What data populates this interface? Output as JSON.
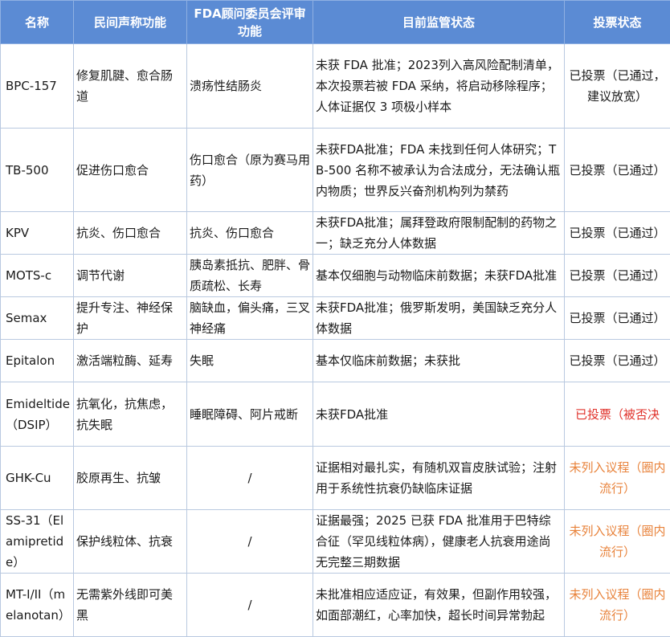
{
  "table": {
    "headers": [
      "名称",
      "民间声称功能",
      "FDA顾问委员会评审功能",
      "目前监管状态",
      "投票状态"
    ],
    "rows": [
      {
        "name": "BPC-157",
        "claimed": "修复肌腱、愈合肠道",
        "fda_function": "溃疡性结肠炎",
        "regulatory": "未获 FDA 批准；2023列入高风险配制清单，本次投票若被 FDA 采纳，将启动移除程序；人体证据仅 3 项极小样本",
        "vote": "已投票（已通过， 建议放宽）",
        "vote_type": "passed"
      },
      {
        "name": "TB-500",
        "claimed": "促进伤口愈合",
        "fda_function": "伤口愈合（原为赛马用药）",
        "regulatory": "未获FDA批准；FDA 未找到任何人体研究；TB-500 名称不被承认为合法成分，无法确认瓶内物质；世界反兴奋剂机构列为禁药",
        "vote": "已投票（已通过）",
        "vote_type": "passed"
      },
      {
        "name": "KPV",
        "claimed": "抗炎、伤口愈合",
        "fda_function": "抗炎、伤口愈合",
        "regulatory": "未获FDA批准；属拜登政府限制配制的药物之一；缺乏充分人体数据",
        "vote": "已投票（已通过）",
        "vote_type": "passed"
      },
      {
        "name": "MOTS-c",
        "claimed": "调节代谢",
        "fda_function": "胰岛素抵抗、肥胖、骨质疏松、长寿",
        "regulatory": "基本仅细胞与动物临床前数据；未获FDA批准",
        "vote": "已投票（已通过）",
        "vote_type": "passed"
      },
      {
        "name": "Semax",
        "claimed": "提升专注、神经保护",
        "fda_function": "脑缺血，偏头痛，三叉神经痛",
        "regulatory": "未获FDA批准；俄罗斯发明，美国缺乏充分人体数据",
        "vote": "已投票（已通过）",
        "vote_type": "passed"
      },
      {
        "name": "Epitalon",
        "claimed": "激活端粒酶、延寿",
        "fda_function": "失眠",
        "regulatory": "基本仅临床前数据；未获批",
        "vote": "已投票（已通过）",
        "vote_type": "passed"
      },
      {
        "name": "Emideltide（DSIP）",
        "claimed": "抗氧化，抗焦虑，抗失眠",
        "fda_function": "睡眠障碍、阿片戒断",
        "regulatory": "未获FDA批准",
        "vote": "已投票（被否决",
        "vote_type": "rejected"
      },
      {
        "name": "GHK-Cu",
        "claimed": "胶原再生、抗皱",
        "fda_function": "/",
        "regulatory": "证据相对最扎实，有随机双盲皮肤试验；注射用于系统性抗衰仍缺临床证据",
        "vote": "未列入议程（圈内流行）",
        "vote_type": "unlisted"
      },
      {
        "name": "SS-31（Elamipretide）",
        "claimed": "保护线粒体、抗衰",
        "fda_function": "/",
        "regulatory": "证据最强；2025 已获 FDA 批准用于巴特综合征（罕见线粒体病），健康老人抗衰用途尚无完整三期数据",
        "vote": "未列入议程（圈内流行）",
        "vote_type": "unlisted"
      },
      {
        "name": "MT-I/II（melanotan）",
        "claimed": "无需紫外线即可美黑",
        "fda_function": "/",
        "regulatory": "未批准相应适应证，有效果，但副作用较强，如面部潮红，心率加快，超长时间异常勃起",
        "vote": "未列入议程（圈内流行）",
        "vote_type": "unlisted"
      }
    ]
  },
  "colors": {
    "header_bg": "#5b8bd4",
    "passed": "#1a1a1a",
    "rejected": "#e0322b",
    "unlisted": "#e8823a"
  }
}
